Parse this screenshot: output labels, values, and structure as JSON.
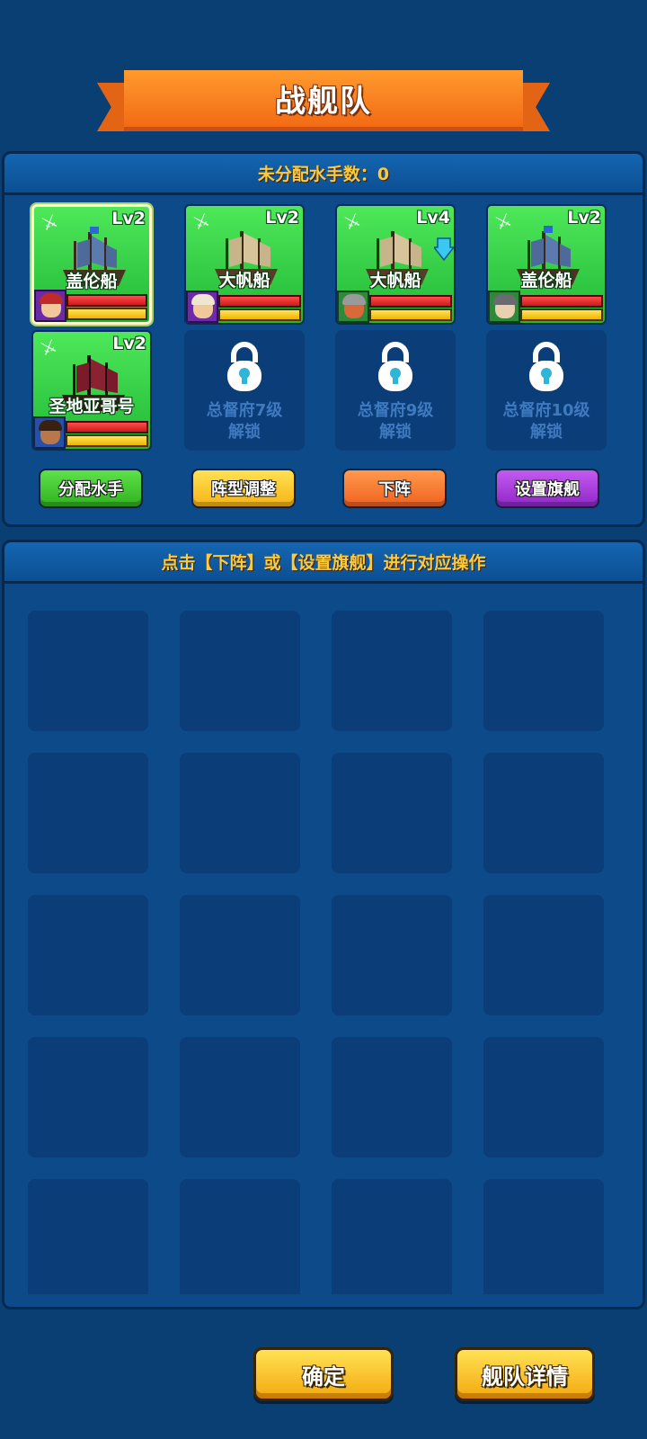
{
  "title": "战舰队",
  "unassigned": {
    "label": "未分配水手数：0"
  },
  "ships": [
    {
      "name": "盖伦船",
      "level": "Lv2",
      "captain_color": "purple",
      "selected": true,
      "upgrade_arrow": false
    },
    {
      "name": "大帆船",
      "level": "Lv2",
      "captain_color": "purple",
      "selected": false,
      "upgrade_arrow": false
    },
    {
      "name": "大帆船",
      "level": "Lv4",
      "captain_color": "green",
      "selected": false,
      "upgrade_arrow": true
    },
    {
      "name": "盖伦船",
      "level": "Lv2",
      "captain_color": "green",
      "selected": false,
      "upgrade_arrow": false
    },
    {
      "name": "圣地亚哥号",
      "level": "Lv2",
      "captain_color": "blue",
      "selected": false,
      "upgrade_arrow": false
    }
  ],
  "locked_slots": [
    {
      "line1": "总督府7级",
      "line2": "解锁"
    },
    {
      "line1": "总督府9级",
      "line2": "解锁"
    },
    {
      "line1": "总督府10级",
      "line2": "解锁"
    }
  ],
  "actions": {
    "assign": "分配水手",
    "formation": "阵型调整",
    "remove": "下阵",
    "flagship": "设置旗舰"
  },
  "inventory": {
    "hint": "点击【下阵】或【设置旗舰】进行对应操作"
  },
  "footer": {
    "confirm": "确定",
    "details": "舰队详情"
  },
  "colors": {
    "background": "#0a3f74",
    "banner": "#f36b14",
    "header_text": "#ffc93a",
    "card_green": "#22b837"
  }
}
